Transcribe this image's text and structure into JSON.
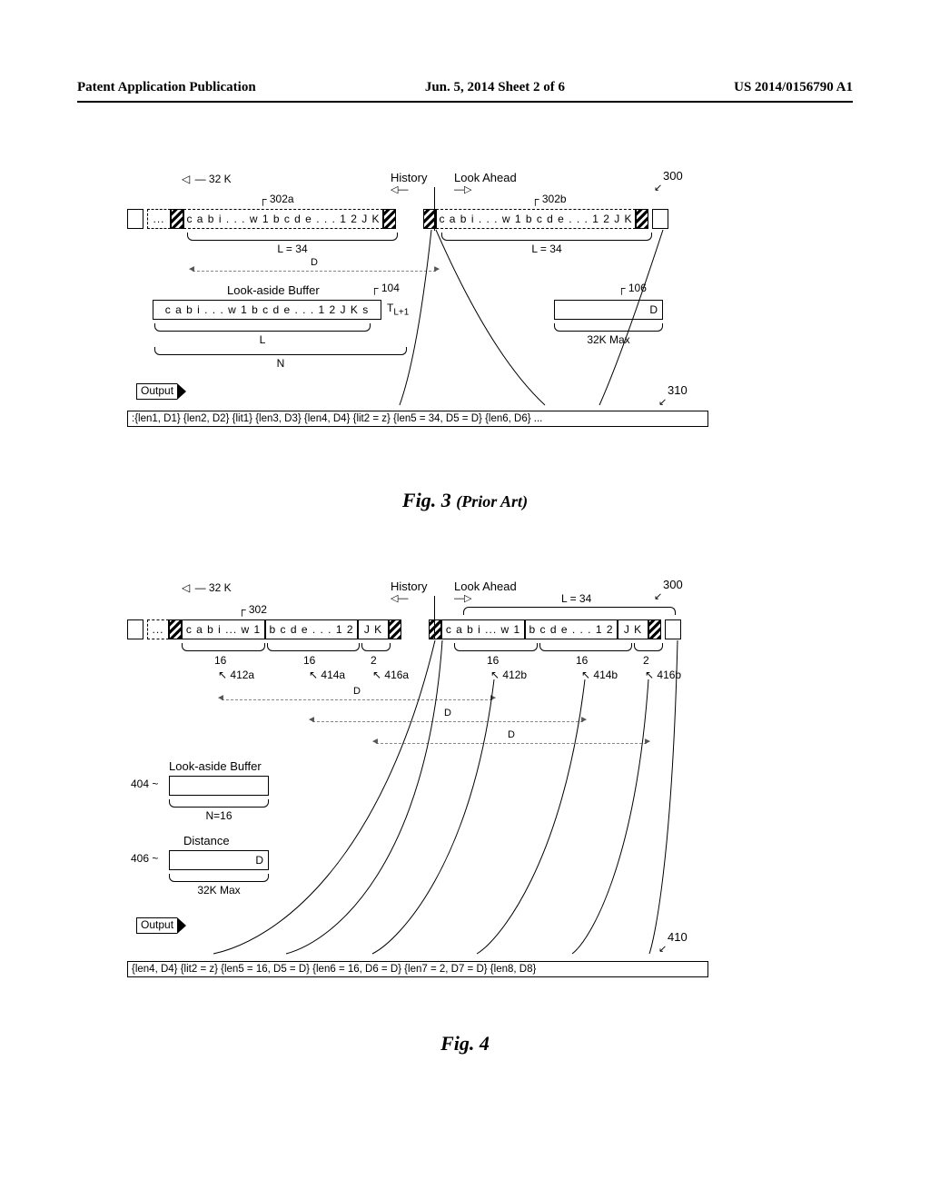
{
  "header": {
    "left": "Patent Application Publication",
    "center": "Jun. 5, 2014  Sheet 2 of 6",
    "right": "US 2014/0156790 A1"
  },
  "fig3": {
    "label_32k": "32 K",
    "label_history": "History",
    "label_lookahead": "Look Ahead",
    "ref_300": "300",
    "ref_302a": "302a",
    "ref_302b": "302b",
    "ref_104": "104",
    "ref_106": "106",
    "ref_310": "310",
    "buf_ellipsis": "...",
    "buf_left": "c a b i . . . w 1 b c d e . . . 1 2 J K",
    "buf_right": "c a b i . . . w 1 b c d e . . . 1 2 J K",
    "brace_L34_left": "L = 34",
    "brace_L34_right": "L = 34",
    "dim_D": "D",
    "lookaside_label": "Look-aside Buffer",
    "lookaside_content": "c a b i . . . w 1 b c d e . . . 1 2 J K s",
    "TL1": "T",
    "TL1_sub": "L+1",
    "brace_L": "L",
    "brace_N": "N",
    "box_D": "D",
    "brace_32Kmax": "32K Max",
    "output_label": "Output",
    "output_text": ":{len1, D1} {len2, D2} {lit1} {len3, D3} {len4, D4} {lit2 = z} {len5 = 34, D5 = D} {len6, D6} ..."
  },
  "fig3_caption": "Fig. 3",
  "fig3_caption_sub": "(Prior Art)",
  "fig4": {
    "label_32k": "32 K",
    "label_history": "History",
    "label_lookahead": "Look Ahead",
    "label_L34": "L = 34",
    "ref_300": "300",
    "ref_302": "302",
    "buf_ellipsis": "...",
    "seg_left_1": "c a b i ... w 1",
    "seg_left_2": "b c d e . . . 1 2",
    "seg_left_3": "J K",
    "seg_right_1": "c a b i ... w 1",
    "seg_right_2": "b c d e . . . 1 2",
    "seg_right_3": "J K",
    "n16": "16",
    "n2": "2",
    "ref_412a": "412a",
    "ref_414a": "414a",
    "ref_416a": "416a",
    "ref_412b": "412b",
    "ref_414b": "414b",
    "ref_416b": "416b",
    "ref_404": "404",
    "ref_406": "406",
    "ref_410": "410",
    "dim_D": "D",
    "lookaside_label": "Look-aside Buffer",
    "brace_N16": "N=16",
    "distance_label": "Distance",
    "box_D": "D",
    "brace_32Kmax": "32K Max",
    "output_label": "Output",
    "output_text": "{len4, D4} {lit2 = z} {len5 = 16, D5 = D} {len6 = 16, D6 = D} {len7 = 2, D7 = D} {len8, D8}"
  },
  "fig4_caption": "Fig. 4"
}
